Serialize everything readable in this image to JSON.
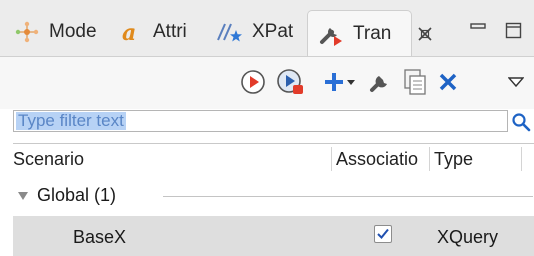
{
  "tabs": [
    {
      "label": "Mode",
      "icon": "model-icon"
    },
    {
      "label": "Attri",
      "icon": "attribute-icon"
    },
    {
      "label": "XPat",
      "icon": "xpath-icon"
    },
    {
      "label": "Tran",
      "icon": "transformation-icon",
      "active": true
    }
  ],
  "toolbar": {
    "icons": [
      "run-icon",
      "debug-run-icon",
      "add-icon",
      "dropdown-arrow-icon",
      "wrench-icon",
      "duplicate-icon",
      "remove-icon",
      "view-menu-icon"
    ]
  },
  "filter": {
    "placeholder": "Type filter text"
  },
  "table": {
    "columns": [
      "Scenario",
      "Associatio",
      "Type"
    ],
    "group": {
      "label": "Global (1)",
      "expanded": true
    },
    "rows": [
      {
        "name": "BaseX",
        "associated": true,
        "type": "XQuery"
      }
    ]
  },
  "colors": {
    "accent_blue": "#1e63c5",
    "run_red": "#e23b2a",
    "add_blue": "#2a6fd6",
    "selection_highlight": "#b7d2f5"
  }
}
